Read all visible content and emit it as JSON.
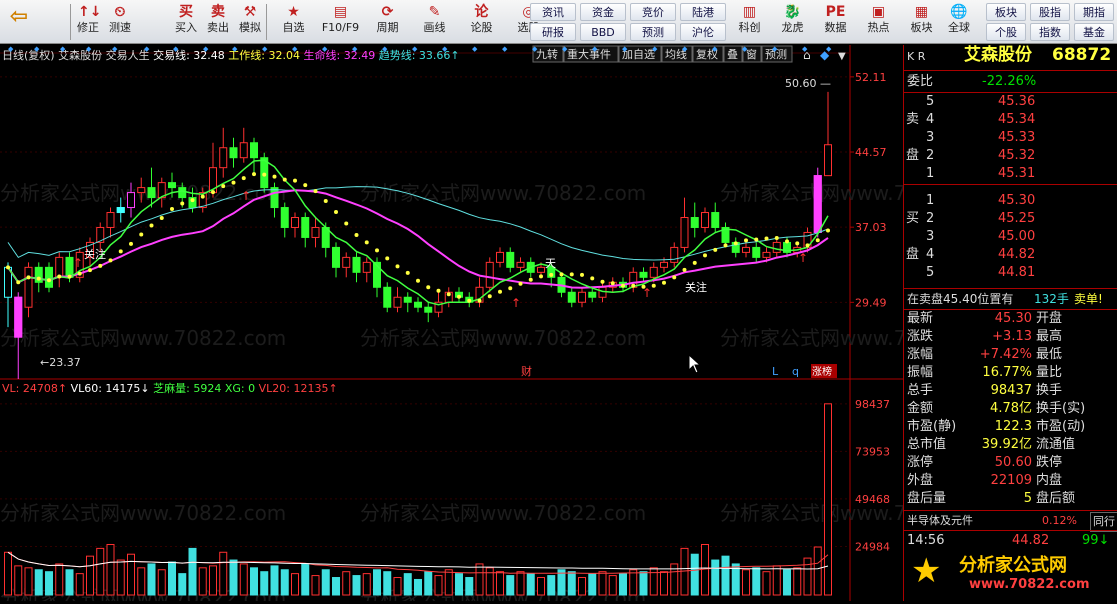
{
  "toolbar": {
    "row1": [
      {
        "label": "修正",
        "icon": "↑↓"
      },
      {
        "label": "测速",
        "icon": "⏲"
      },
      {
        "label": "买入",
        "icon": "买"
      },
      {
        "label": "卖出",
        "icon": "卖"
      },
      {
        "label": "模拟",
        "icon": "⚒"
      }
    ],
    "row2": [
      {
        "label": "自选",
        "icon": "★"
      },
      {
        "label": "F10/F9",
        "icon": "▤"
      },
      {
        "label": "周期",
        "icon": "⟳"
      },
      {
        "label": "画线",
        "icon": "✎"
      },
      {
        "label": "论股",
        "icon": "论"
      },
      {
        "label": "选股",
        "icon": "◎"
      }
    ],
    "small": [
      [
        "资讯",
        "资金",
        "竞价",
        "陆港"
      ],
      [
        "研报",
        "BBD",
        "预测",
        "沪伦"
      ]
    ],
    "row3": [
      {
        "label": "科创",
        "icon": "▥"
      },
      {
        "label": "龙虎",
        "icon": "🐉"
      },
      {
        "label": "数据",
        "icon": "PE"
      },
      {
        "label": "热点",
        "icon": "▣"
      },
      {
        "label": "板块",
        "icon": "▦"
      }
    ],
    "globe": {
      "label": "全球",
      "icon": "🌐"
    },
    "right": [
      [
        "板块",
        "股指",
        "期指"
      ],
      [
        "个股",
        "指数",
        "基金"
      ]
    ]
  },
  "chart_header": {
    "period": "日线(复权)",
    "name": "艾森股份",
    "indicator": "交易人生",
    "items": [
      {
        "label": "交易线: 32.48",
        "color": "#ffffff"
      },
      {
        "label": "工作线: 32.04",
        "color": "#ffff40"
      },
      {
        "label": "生命线: 32.49",
        "color": "#ff40ff"
      },
      {
        "label": "趋势线: 33.66",
        "color": "#40e0e0",
        "arrow": "↑"
      }
    ]
  },
  "chart_tabs": [
    "九转",
    "重大事件",
    "加自选",
    "均线",
    "复权",
    "叠",
    "窗",
    "预测"
  ],
  "price_axis": [
    "52.11",
    "44.57",
    "37.03",
    "29.49"
  ],
  "vol_axis": [
    "98437",
    "73953",
    "49468",
    "24984"
  ],
  "annotations": {
    "high": "50.60",
    "low": "23.37",
    "follow1": "关注",
    "follow2": "关注",
    "tian": "天",
    "cai": "财",
    "L": "L",
    "q": "q",
    "zhangbang": "涨榜"
  },
  "vol_header": {
    "items": [
      {
        "label": "VL: 24708",
        "color": "#ff4040",
        "arrow": "↑"
      },
      {
        "label": "VL60: 14175",
        "color": "#ffffff",
        "arrow": "↓"
      },
      {
        "label": "芝麻量: 5924",
        "color": "#40ff40"
      },
      {
        "label": "XG: 0",
        "color": "#40ff40"
      },
      {
        "label": "VL20: 12135",
        "color": "#ff4040",
        "arrow": "↑"
      }
    ]
  },
  "watermark": "分析家公式网www.70822.com",
  "panel": {
    "market": "K R",
    "name": "艾森股份",
    "code": "68872",
    "weibi_label": "委比",
    "weibi": "-22.26%",
    "sell_label": [
      "卖",
      "盘"
    ],
    "buy_label": [
      "买",
      "盘"
    ],
    "asks": [
      {
        "lvl": "5",
        "price": "45.36"
      },
      {
        "lvl": "4",
        "price": "45.34"
      },
      {
        "lvl": "3",
        "price": "45.33"
      },
      {
        "lvl": "2",
        "price": "45.32"
      },
      {
        "lvl": "1",
        "price": "45.31"
      }
    ],
    "bids": [
      {
        "lvl": "1",
        "price": "45.30"
      },
      {
        "lvl": "2",
        "price": "45.25"
      },
      {
        "lvl": "3",
        "price": "45.00"
      },
      {
        "lvl": "4",
        "price": "44.82"
      },
      {
        "lvl": "5",
        "price": "44.81"
      }
    ],
    "notice": "在卖盘45.40位置有",
    "notice_qty": "132手",
    "notice_tag": "卖单!",
    "stats": [
      {
        "l": "最新",
        "v": "45.30",
        "c": "red",
        "r": "开盘"
      },
      {
        "l": "涨跌",
        "v": "+3.13",
        "c": "red",
        "r": "最高"
      },
      {
        "l": "涨幅",
        "v": "+7.42%",
        "c": "red",
        "r": "最低"
      },
      {
        "l": "振幅",
        "v": "16.77%",
        "c": "yel",
        "r": "量比"
      },
      {
        "l": "总手",
        "v": "98437",
        "c": "yel",
        "r": "换手"
      },
      {
        "l": "金额",
        "v": "4.78亿",
        "c": "yel",
        "r": "换手(实)"
      },
      {
        "l": "市盈(静)",
        "v": "122.3",
        "c": "yel",
        "r": "市盈(动)"
      },
      {
        "l": "总市值",
        "v": "39.92亿",
        "c": "yel",
        "r": "流通值"
      },
      {
        "l": "涨停",
        "v": "50.60",
        "c": "red",
        "r": "跌停"
      },
      {
        "l": "外盘",
        "v": "22109",
        "c": "red",
        "r": "内盘"
      },
      {
        "l": "盘后量",
        "v": "5",
        "c": "yel",
        "r": "盘后额"
      }
    ],
    "sector": "半导体及元件",
    "sector_pct": "0.12%",
    "sector_tab": "同行",
    "tick": {
      "time": "14:56",
      "price": "44.82",
      "vol": "99"
    },
    "logo_text": "分析家公式网",
    "logo_url": "www.70822.com"
  },
  "chart_data": {
    "type": "candlestick",
    "y_axis_ticks": [
      52.11,
      44.57,
      37.03,
      29.49
    ],
    "ylim": [
      22.0,
      53.5
    ],
    "vol_ticks": [
      98437,
      73953,
      49468,
      24984
    ],
    "candles": [
      [
        30,
        33,
        27,
        33.5
      ],
      [
        26,
        30,
        21.8,
        30.5
      ],
      [
        29,
        33,
        28,
        33.5
      ],
      [
        33,
        31.5,
        30.5,
        33.5
      ],
      [
        33,
        31,
        30.5,
        33.5
      ],
      [
        32,
        34,
        31,
        34.5
      ],
      [
        34,
        32,
        31.5,
        34.5
      ],
      [
        32,
        34.5,
        31.5,
        35
      ],
      [
        34,
        35.5,
        33,
        36
      ],
      [
        35.5,
        37,
        34.5,
        37.5
      ],
      [
        37,
        38.5,
        36,
        39
      ],
      [
        38.5,
        39,
        37.5,
        40
      ],
      [
        39,
        40.5,
        38,
        41.5
      ],
      [
        40.5,
        41,
        39.5,
        42
      ],
      [
        41,
        40,
        39,
        43
      ],
      [
        40,
        41.5,
        39,
        42
      ],
      [
        41.5,
        41,
        40,
        42.5
      ],
      [
        41,
        40,
        39,
        41.5
      ],
      [
        40,
        39,
        38.5,
        41
      ],
      [
        39,
        40.5,
        38.5,
        41
      ],
      [
        40.5,
        43,
        40,
        45.5
      ],
      [
        43,
        45,
        42,
        47
      ],
      [
        45,
        44,
        43,
        46
      ],
      [
        44,
        45.5,
        43.5,
        47
      ],
      [
        45.5,
        44,
        42.5,
        46
      ],
      [
        44,
        41,
        40.5,
        44.5
      ],
      [
        41,
        39,
        38,
        41.5
      ],
      [
        39,
        37,
        36,
        39.5
      ],
      [
        37,
        38,
        36,
        38.5
      ],
      [
        38,
        36,
        35,
        38.5
      ],
      [
        36,
        37,
        35,
        38
      ],
      [
        37,
        35,
        34,
        37.5
      ],
      [
        35,
        33,
        32,
        35.5
      ],
      [
        33,
        34,
        32,
        34.5
      ],
      [
        34,
        32.5,
        31.5,
        34.5
      ],
      [
        32.5,
        33.5,
        31.5,
        34
      ],
      [
        33.5,
        31,
        30,
        34
      ],
      [
        31,
        29,
        28.5,
        31.5
      ],
      [
        29,
        30,
        28.5,
        31
      ],
      [
        30,
        29.5,
        28.5,
        30.5
      ],
      [
        29.5,
        29,
        28.5,
        30
      ],
      [
        29,
        28.5,
        27.5,
        29.5
      ],
      [
        28.5,
        29.5,
        28,
        30.5
      ],
      [
        29.5,
        30.5,
        29,
        31
      ],
      [
        30.5,
        30,
        29.5,
        31
      ],
      [
        30,
        29.5,
        29,
        30.5
      ],
      [
        29.5,
        31,
        29,
        32
      ],
      [
        31,
        33.5,
        30.5,
        34
      ],
      [
        33.5,
        34.5,
        33,
        35
      ],
      [
        34.5,
        33,
        32.5,
        35
      ],
      [
        33,
        33.5,
        32.5,
        34
      ],
      [
        33.5,
        32.5,
        32,
        34
      ],
      [
        32.5,
        33,
        32,
        33.5
      ],
      [
        33,
        32,
        31,
        33.5
      ],
      [
        32,
        30.5,
        30,
        32.5
      ],
      [
        30.5,
        29.5,
        29,
        31
      ],
      [
        29.5,
        30.5,
        29,
        31
      ],
      [
        30.5,
        30,
        29.5,
        31
      ],
      [
        30,
        31,
        29.5,
        31.5
      ],
      [
        31,
        31.5,
        30.5,
        32
      ],
      [
        31.5,
        31,
        30.5,
        32
      ],
      [
        31,
        32.5,
        30.5,
        33
      ],
      [
        32.5,
        32,
        31.5,
        33
      ],
      [
        32,
        33,
        31.5,
        33.5
      ],
      [
        33,
        33.5,
        32.5,
        34
      ],
      [
        33.5,
        35,
        33,
        35.5
      ],
      [
        35,
        38,
        34.5,
        40
      ],
      [
        38,
        37,
        36,
        39.5
      ],
      [
        37,
        38.5,
        36.5,
        39
      ],
      [
        38.5,
        37,
        36.5,
        39.5
      ],
      [
        37,
        35.5,
        35,
        37.5
      ],
      [
        35.5,
        34.5,
        34,
        36
      ],
      [
        34.5,
        35,
        34,
        35.5
      ],
      [
        35,
        34,
        33.5,
        35.5
      ],
      [
        34,
        34.5,
        33.5,
        35
      ],
      [
        34.5,
        35.5,
        34,
        36
      ],
      [
        35.5,
        34.5,
        34,
        36
      ],
      [
        34.5,
        35,
        34,
        35.5
      ],
      [
        35,
        36.5,
        34.5,
        37
      ],
      [
        36.5,
        42.2,
        36,
        43
      ],
      [
        42.2,
        45.3,
        42.5,
        50.6
      ]
    ],
    "volumes": [
      22000,
      15000,
      14000,
      13000,
      12000,
      16000,
      13000,
      11000,
      20000,
      24000,
      26000,
      18000,
      21000,
      14000,
      16000,
      13000,
      17000,
      11000,
      24000,
      14000,
      15000,
      22000,
      18000,
      16000,
      14000,
      12000,
      15000,
      13000,
      11000,
      16000,
      10000,
      13000,
      9000,
      12000,
      10000,
      11000,
      13000,
      12000,
      9000,
      11000,
      8000,
      12000,
      10000,
      13000,
      11000,
      9000,
      16000,
      14000,
      12000,
      10000,
      12000,
      11000,
      9000,
      10000,
      13000,
      12000,
      9000,
      11000,
      12000,
      10000,
      11000,
      13000,
      12000,
      14000,
      12000,
      16000,
      24000,
      21000,
      26000,
      18000,
      20000,
      16000,
      13000,
      14000,
      12000,
      15000,
      13000,
      14000,
      19000,
      24708,
      98437
    ]
  }
}
